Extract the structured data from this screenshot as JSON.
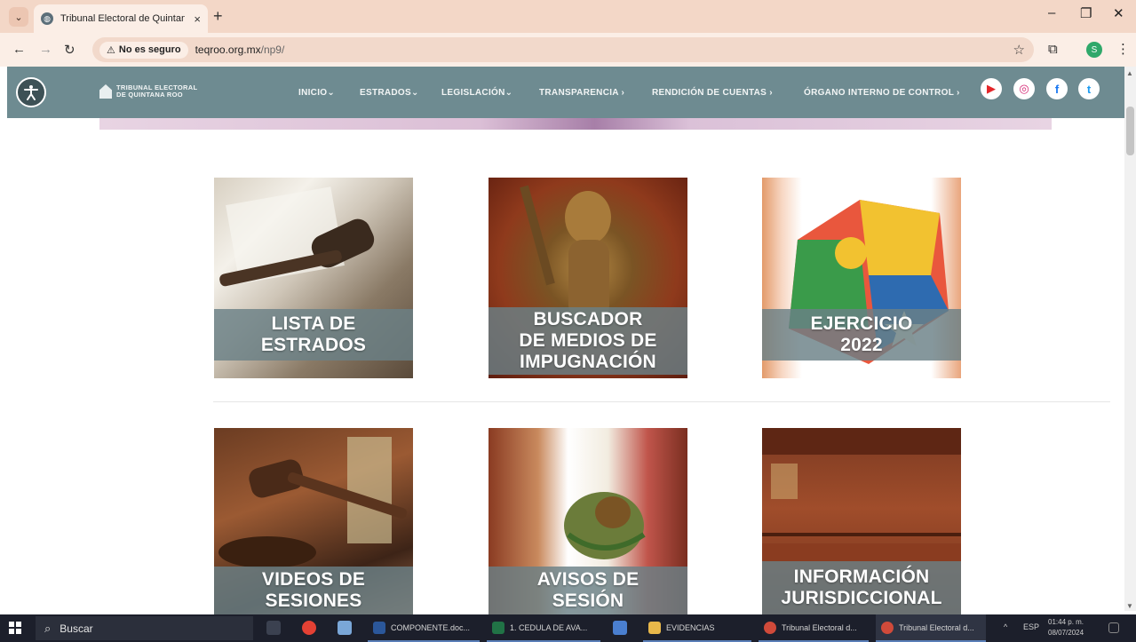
{
  "browser": {
    "tab_title": "Tribunal Electoral de Quintana",
    "tab_close": "×",
    "new_tab": "+",
    "security_label": "No es seguro",
    "url_host": "teqroo.org.mx",
    "url_path": "/np9/",
    "profile_initial": "S",
    "window_controls": {
      "minimize": "–",
      "maximize": "❐",
      "close": "✕"
    }
  },
  "site": {
    "logo_line1": "TRIBUNAL ELECTORAL",
    "logo_line2": "DE QUINTANA ROO",
    "nav": [
      {
        "label": "INICIO⌄"
      },
      {
        "label": "ESTRADOS⌄"
      },
      {
        "label": "LEGISLACIÓN⌄"
      },
      {
        "label": "TRANSPARENCIA ›"
      },
      {
        "label": "RENDICIÓN DE CUENTAS ›"
      },
      {
        "label": "ÓRGANO INTERNO DE CONTROL ›"
      }
    ],
    "social": [
      {
        "icon": "youtube-icon",
        "glyph": "▶",
        "color": "#e4262a"
      },
      {
        "icon": "instagram-icon",
        "glyph": "◎",
        "color": "#d62976"
      },
      {
        "icon": "facebook-icon",
        "glyph": "f",
        "color": "#1877f2"
      },
      {
        "icon": "twitter-icon",
        "glyph": "t",
        "color": "#1d9bf0"
      }
    ]
  },
  "cards": [
    {
      "label": "LISTA DE\nESTRADOS"
    },
    {
      "label": "BUSCADOR\nDE MEDIOS DE\nIMPUGNACIÓN"
    },
    {
      "label": "EJERCICIO\n2022"
    },
    {
      "label": "VIDEOS DE\nSESIONES"
    },
    {
      "label": "AVISOS DE\nSESIÓN"
    },
    {
      "label": "INFORMACIÓN\nJURISDICCIONAL"
    }
  ],
  "taskbar": {
    "search_label": "Buscar",
    "items": [
      {
        "label": "COMPONENTE.doc...",
        "color": "#2b579a"
      },
      {
        "label": "1. CEDULA DE AVA...",
        "color": "#217346"
      },
      {
        "label": "EVIDENCIAS",
        "color": "#e8b84a"
      },
      {
        "label": "Tribunal Electoral d...",
        "color": "#d04a3a"
      },
      {
        "label": "Tribunal Electoral d...",
        "color": "#d04a3a"
      }
    ],
    "lang": "ESP",
    "time": "01:44 p. m.",
    "date": "08/07/2024"
  }
}
